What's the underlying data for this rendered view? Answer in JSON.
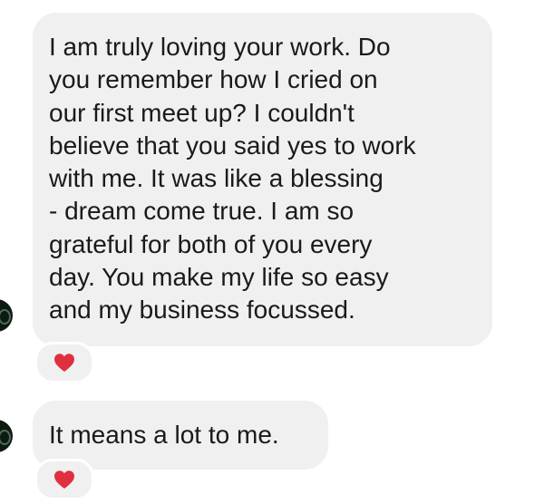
{
  "messages": [
    {
      "sender": "other",
      "lines": [
        "I am truly loving your work. Do",
        "you remember how I cried on",
        "our first meet up? I couldn't",
        "believe that you said yes to work",
        "with me. It was like a blessing",
        "- dream come true. I am so",
        "grateful for both of you every",
        "day. You make my life so easy",
        "and my business focussed."
      ],
      "reaction": "heart-icon"
    },
    {
      "sender": "other",
      "lines": [
        "It means a lot to me."
      ],
      "reaction": "heart-icon"
    }
  ],
  "colors": {
    "bubble_bg": "#f0f0f1",
    "text": "#1a1a1a",
    "heart": "#e0303f",
    "avatar": "#0d1a12"
  }
}
